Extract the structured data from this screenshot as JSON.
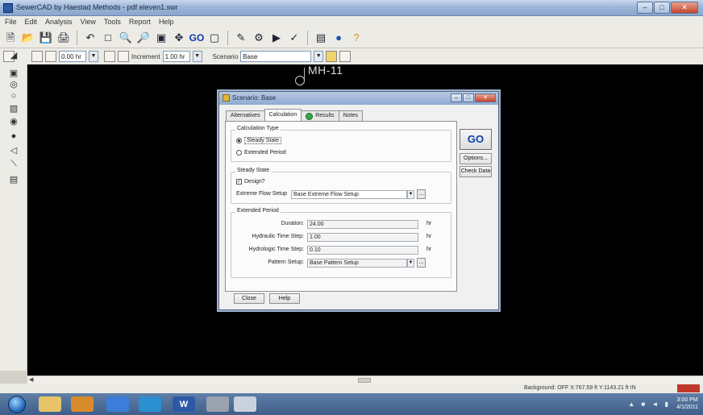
{
  "app": {
    "title": "SewerCAD by Haestad Methods - pdf eleven1.swr",
    "controls": {
      "minimize": "–",
      "maximize": "□",
      "close": "✕"
    }
  },
  "menubar": [
    "File",
    "Edit",
    "Analysis",
    "View",
    "Tools",
    "Report",
    "Help"
  ],
  "toolbar": {
    "buttons": [
      "new-icon",
      "open-icon",
      "save-icon",
      "print-icon",
      "undo-icon",
      "redo-icon",
      "select-icon",
      "zoom-in-icon",
      "zoom-out-icon",
      "zoom-window-icon",
      "zoom-extents-icon",
      "go-icon",
      "element-icon",
      "pipe-icon",
      "manhole-icon",
      "outlet-icon",
      "alternative-icon",
      "globe-icon",
      "help-icon"
    ],
    "go_label": "GO"
  },
  "toolbar2": {
    "time_value": "0.00 hr",
    "increment_label": "Increment",
    "increment_value": "1.00 hr",
    "scenario_label": "Scenario",
    "scenario_value": "Base"
  },
  "drawing": {
    "node_label": "MH-11"
  },
  "status": {
    "text": "Background: OFF  X:767.59 ft  Y:1143.21 ft  IN"
  },
  "taskbar": {
    "clock_time": "3:00 PM",
    "clock_date": "4/1/2011",
    "word_label": "W"
  },
  "dialog": {
    "title": "Scenario: Base",
    "tabs": [
      "Alternatives",
      "Calculation",
      "Results",
      "Notes"
    ],
    "active_tab": "Calculation",
    "calc_type": {
      "title": "Calculation Type",
      "options": [
        "Steady State",
        "Extended Period"
      ],
      "selected": "Steady State"
    },
    "steady_state": {
      "title": "Steady State",
      "design_label": "Design?",
      "design_checked": true,
      "flow_setup_label": "Extreme Flow Setup",
      "flow_setup_value": "Base Extreme Flow Setup"
    },
    "extended_period": {
      "title": "Extended Period",
      "duration_label": "Duration:",
      "duration_value": "24.00",
      "hydraulic_step_label": "Hydraulic Time Step:",
      "hydraulic_step_value": "1.00",
      "hydrologic_step_label": "Hydrologic Time Step:",
      "hydrologic_step_value": "0.10",
      "unit": "hr",
      "pattern_label": "Pattern Setup:",
      "pattern_value": "Base Pattern Setup"
    },
    "buttons": {
      "go": "GO",
      "options": "Options...",
      "check_data": "Check Data",
      "close": "Close",
      "help": "Help"
    }
  }
}
